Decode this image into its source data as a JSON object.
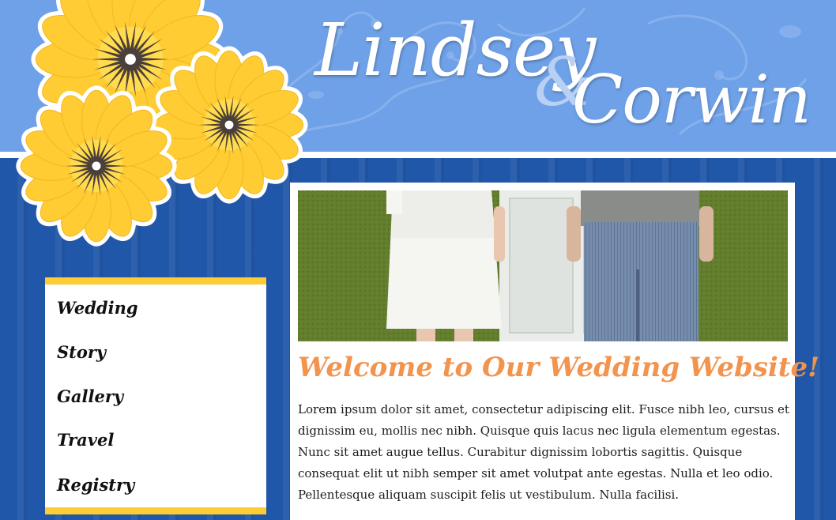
{
  "header": {
    "name_first": "Lindsey",
    "ampersand": "&",
    "name_second": "Corwin"
  },
  "nav": {
    "items": [
      {
        "label": "Wedding"
      },
      {
        "label": "Story"
      },
      {
        "label": "Gallery"
      },
      {
        "label": "Travel"
      },
      {
        "label": "Registry"
      }
    ]
  },
  "main": {
    "heading": "Welcome to Our Wedding Website!",
    "body": "Lorem ipsum dolor sit amet, consectetur adipiscing elit. Fusce nibh leo, cursus et dignissim eu, mollis nec nibh. Quisque quis lacus nec ligula elementum egestas. Nunc sit amet augue tellus. Curabitur dignissim lobortis sagittis. Quisque consequat elit ut nibh semper sit amet volutpat ante egestas. Nulla et leo odio. Pellentesque aliquam suscipit felis ut vestibulum. Nulla facilisi."
  },
  "colors": {
    "header_blue": "#6fa1e8",
    "body_blue": "#2157a8",
    "flower_yellow": "#ffcc33",
    "heading_orange": "#f2934e",
    "nav_accent": "#ffcc33"
  },
  "icons": {
    "flowers": "yellow-daisy-flowers",
    "photo": "couple-photo"
  }
}
